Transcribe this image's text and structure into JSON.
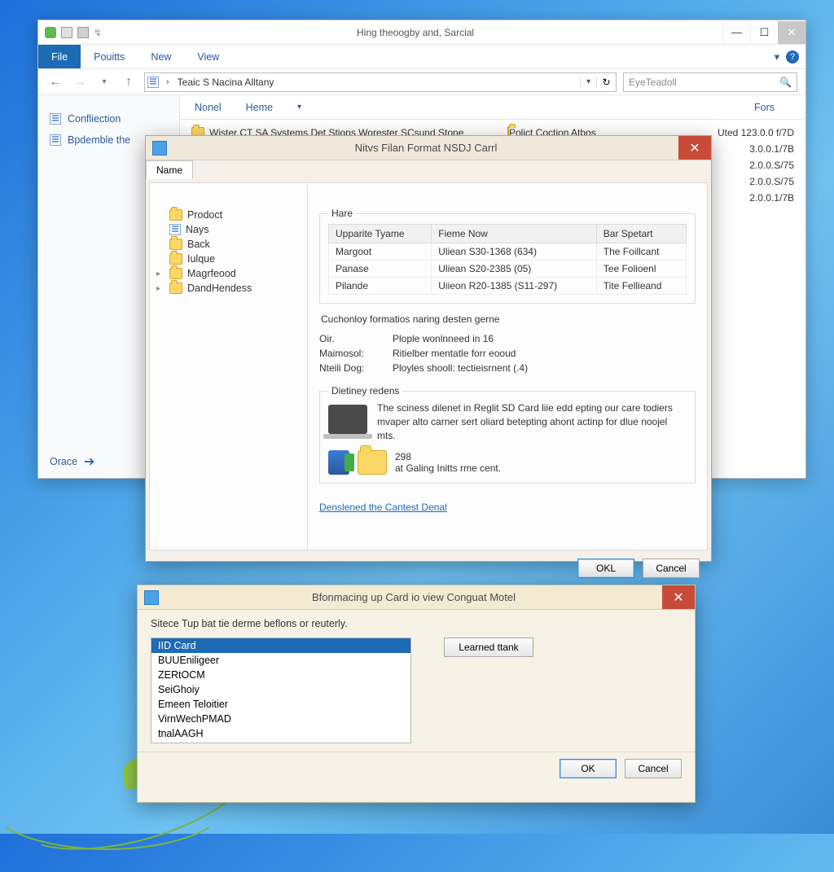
{
  "explorer": {
    "quick_icons": [
      "app",
      "doc",
      "save",
      "pin"
    ],
    "title": "Hing theoogby and, Sarcial",
    "menu": {
      "file": "File",
      "pouitts": "Pouitts",
      "new": "New",
      "view": "View"
    },
    "nav": {
      "back": "←",
      "fwd": "→",
      "up": "↑",
      "refresh": "↻"
    },
    "breadcrumb": [
      "Teaic S Nacina Alltany"
    ],
    "search_placeholder": "EyeTeadoll",
    "columns": {
      "c1": "Nonel",
      "c2": "Heme",
      "c3": "Fors"
    },
    "sidebar": {
      "items": [
        {
          "label": "Confliection"
        },
        {
          "label": "Bpdemble the"
        }
      ],
      "footer": "Orace"
    },
    "rows": [
      {
        "name": "Wister CT SA Systems Det Stions Worester SCsund Stone",
        "mid": "Polict Coction Atbos",
        "right": "Uted 123.0.0 f/7D"
      },
      {
        "name": "",
        "mid": "",
        "right": "3.0.0.1/7B"
      },
      {
        "name": "",
        "mid": "",
        "right": "2.0.0.S/75"
      },
      {
        "name": "",
        "mid": "",
        "right": "2.0.0.S/75"
      },
      {
        "name": "",
        "mid": "",
        "right": "2.0.0.1/7B"
      }
    ]
  },
  "dlg1": {
    "title": "Nitvs Filan Format NSDJ Carrl",
    "tab": "Name",
    "tree": [
      {
        "label": "Prodoct",
        "exp": ""
      },
      {
        "label": "Nays",
        "exp": "",
        "icon": "page"
      },
      {
        "label": "Back",
        "exp": ""
      },
      {
        "label": "Iulque",
        "exp": ""
      },
      {
        "label": "Magrfeood",
        "exp": "▸"
      },
      {
        "label": "DandHendess",
        "exp": "▸"
      }
    ],
    "hare_legend": "Hare",
    "table": {
      "headers": [
        "Upparite Tyame",
        "Fieme Now",
        "Bar Spetart"
      ],
      "rows": [
        [
          "Margoot",
          "Uliean S30-1368 (634)",
          "The Foillcant"
        ],
        [
          "Panase",
          "Uliean S20-2385 (05)",
          "Tee Folioenl"
        ],
        [
          "Pilande",
          "Uiieon R20-1385 (S11-297)",
          "Tite Fellieand"
        ]
      ]
    },
    "section2_title": "Cuchonloy formatios naring desten gerne",
    "kv": [
      {
        "k": "Oir.",
        "v": "Plople wonlnneed in 16"
      },
      {
        "k": "Maimosol:",
        "v": "Ritielber mentatle forr eooud"
      },
      {
        "k": "Nteili Dog:",
        "v": "Ployles shooll: tectieisrnent (.4)"
      }
    ],
    "section3_legend": "Dietiney redens",
    "desc": "The sciness dilenet in Reglit SD Card liie edd epting our care todiers mvaper alto carner sert oliard betepting ahont actinp for dlue noojel mts.",
    "count": "298",
    "count_sub": "at Galing Initts rme cent.",
    "link": "Denslened the Cantest Denal",
    "ok": "OKL",
    "cancel": "Cancel"
  },
  "dlg2": {
    "title": "Bfonmacing up Card io view Conguat Motel",
    "instr": "Sitece Tup bat tie derme beflons or reuterly.",
    "items": [
      "IID Card",
      "BUUEniligeer",
      "ZERtOCM",
      "SeiGhoiy",
      "Emeen Teloitier",
      "VirnWechPMAD",
      "tnalAAGH"
    ],
    "selected_index": 0,
    "side_btn": "Learned ttank",
    "ok": "OK",
    "cancel": "Cancel"
  }
}
